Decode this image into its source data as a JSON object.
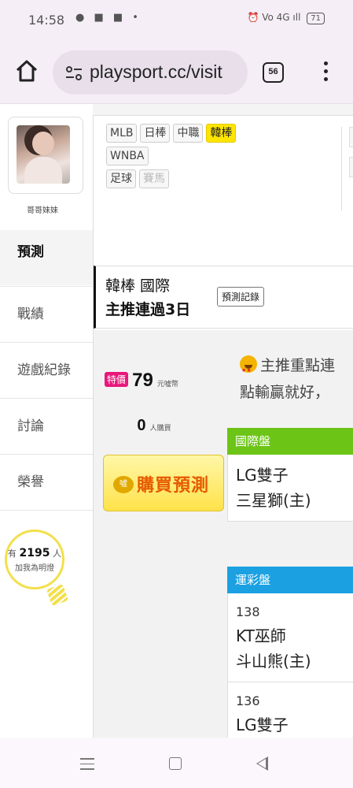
{
  "status_bar": {
    "time": "14:58",
    "left_icons": "● ■ ■ •",
    "right_icons": "⏰ Vo 4G ıll",
    "battery": "71"
  },
  "browser": {
    "url": "playsport.cc/visit",
    "tab_count": "56",
    "home_icon": "home-icon",
    "menu_icon": "more-vert-icon"
  },
  "profile": {
    "name": "哥哥妹妹"
  },
  "sidebar": {
    "tabs": [
      {
        "label": "預測",
        "active": true
      },
      {
        "label": "戰績"
      },
      {
        "label": "遊戲紀錄"
      },
      {
        "label": "討論"
      },
      {
        "label": "榮譽"
      }
    ],
    "fans": {
      "prefix": "有",
      "count": "2195",
      "suffix": "人",
      "line2": "加我為明燈"
    }
  },
  "leagues": {
    "row1": [
      "MLB",
      "日棒",
      "中職",
      "韓棒"
    ],
    "row2": [
      "WNBA"
    ],
    "row3": [
      "足球",
      "賽馬"
    ],
    "selected": "韓棒",
    "disabled": "賽馬"
  },
  "prediction": {
    "title_line1": "韓棒 國際",
    "title_line2": "主推連過3日",
    "record_button": "預測記錄",
    "special_tag": "特價",
    "price": "79",
    "price_unit": "元噓幣",
    "buyers_count": "0",
    "buyers_label": "人購買",
    "buy_button": "購買預測",
    "buy_icon": "噓",
    "note_line1": "主推重點連",
    "note_line2": "點輸贏就好，",
    "markets": [
      {
        "name": "國際盤",
        "color": "#6cc417",
        "teams": [
          "LG雙子",
          "三星獅(主)"
        ]
      },
      {
        "name": "運彩盤",
        "color": "#1ba1e2",
        "games": [
          {
            "number": "138",
            "teams": [
              "KT巫師",
              "斗山熊(主)"
            ]
          },
          {
            "number": "136",
            "teams": [
              "LG雙子"
            ]
          }
        ]
      }
    ]
  },
  "colors": {
    "highlight": "#ffe500",
    "special": "#e8177a",
    "buy_text": "#e65a00"
  }
}
